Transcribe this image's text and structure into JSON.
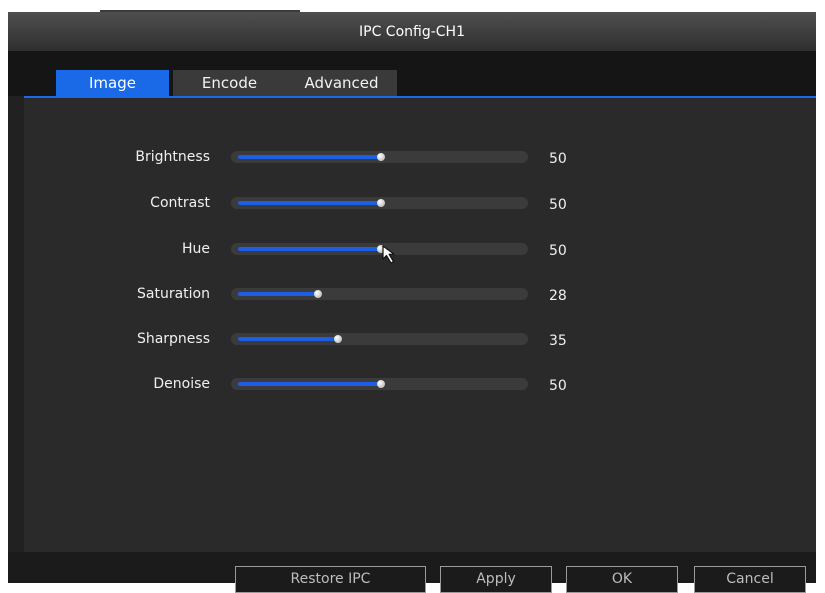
{
  "window": {
    "title": "IPC Config-CH1"
  },
  "tabs": [
    {
      "label": "Image",
      "active": true
    },
    {
      "label": "Encode",
      "active": false
    },
    {
      "label": "Advanced",
      "active": false
    }
  ],
  "settings": [
    {
      "label": "Brightness",
      "value": "50",
      "level": 50
    },
    {
      "label": "Contrast",
      "value": "50",
      "level": 50
    },
    {
      "label": "Hue",
      "value": "50",
      "level": 50
    },
    {
      "label": "Saturation",
      "value": "28",
      "level": 28
    },
    {
      "label": "Sharpness",
      "value": "35",
      "level": 35
    },
    {
      "label": "Denoise",
      "value": "50",
      "level": 50
    }
  ],
  "footer": {
    "restore_label": "Restore IPC",
    "apply_label": "Apply",
    "ok_label": "OK",
    "cancel_label": "Cancel"
  },
  "colors": {
    "accent": "#1a6ae8",
    "slider_fill": "#1e5ee6",
    "background": "#2a2a2a",
    "titlebar": "#3c3c3c"
  },
  "icons": {
    "pointer": "mouse-pointer-icon"
  }
}
